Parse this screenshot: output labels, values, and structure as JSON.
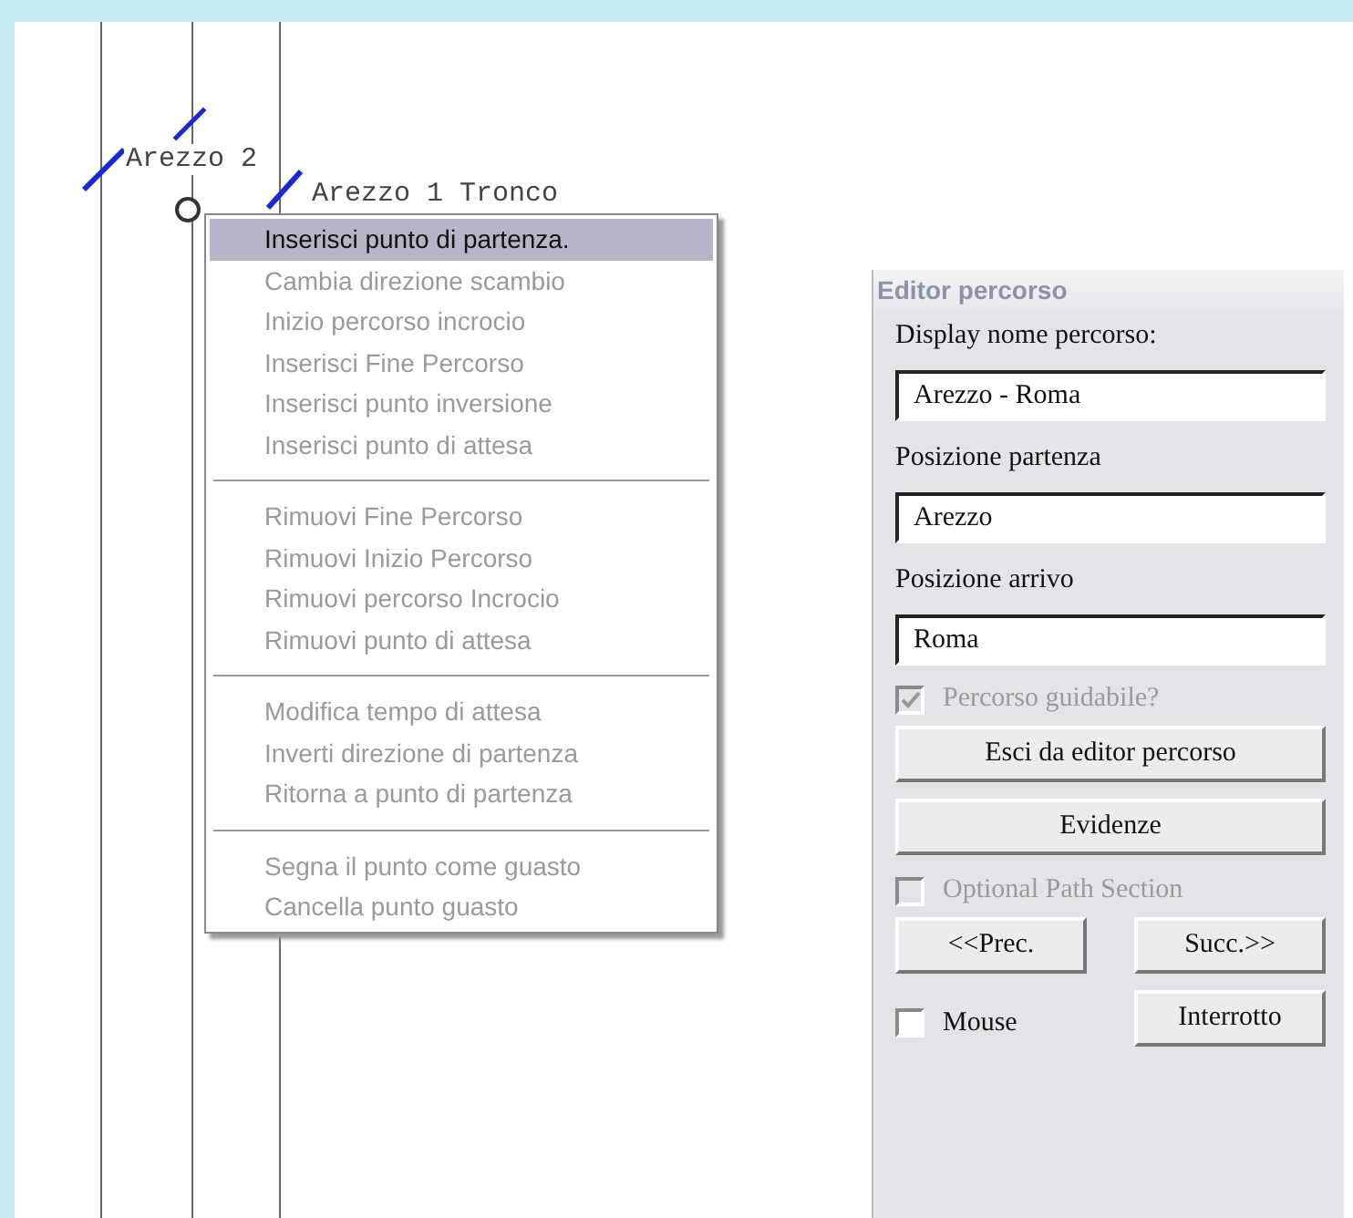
{
  "canvas": {
    "labels": [
      "Arezzo 2",
      "Arezzo 1 Tronco"
    ]
  },
  "context_menu": {
    "groups": [
      [
        {
          "label": "Inserisci punto di partenza.",
          "disabled": false,
          "selected": true
        },
        {
          "label": "Cambia direzione scambio",
          "disabled": true,
          "selected": false
        },
        {
          "label": "Inizio percorso incrocio",
          "disabled": true,
          "selected": false
        },
        {
          "label": "Inserisci Fine Percorso",
          "disabled": true,
          "selected": false
        },
        {
          "label": "Inserisci punto inversione",
          "disabled": true,
          "selected": false
        },
        {
          "label": "Inserisci punto di attesa",
          "disabled": true,
          "selected": false
        }
      ],
      [
        {
          "label": "Rimuovi Fine Percorso",
          "disabled": true,
          "selected": false
        },
        {
          "label": "Rimuovi Inizio Percorso",
          "disabled": true,
          "selected": false
        },
        {
          "label": "Rimuovi percorso Incrocio",
          "disabled": true,
          "selected": false
        },
        {
          "label": "Rimuovi punto di attesa",
          "disabled": true,
          "selected": false
        }
      ],
      [
        {
          "label": "Modifica tempo di attesa",
          "disabled": true,
          "selected": false
        },
        {
          "label": "Inverti direzione di partenza",
          "disabled": true,
          "selected": false
        },
        {
          "label": "Ritorna a punto di partenza",
          "disabled": true,
          "selected": false
        }
      ],
      [
        {
          "label": "Segna il punto come guasto",
          "disabled": true,
          "selected": false
        },
        {
          "label": "Cancella punto guasto",
          "disabled": true,
          "selected": false
        }
      ]
    ]
  },
  "panel": {
    "title": "Editor percorso",
    "fields": [
      {
        "label": "Display nome percorso:",
        "value": "Arezzo - Roma"
      },
      {
        "label": "Posizione partenza",
        "value": "Arezzo"
      },
      {
        "label": "Posizione arrivo",
        "value": "Roma"
      }
    ],
    "driveable": {
      "label": "Percorso guidabile?",
      "checked": true,
      "disabled": true
    },
    "exit_button": "Esci da editor percorso",
    "highlights_button": "Evidenze",
    "optional": {
      "label": "Optional Path Section",
      "checked": false,
      "disabled": true
    },
    "prev_button": "<<Prec.",
    "next_button": "Succ.>>",
    "mouse": {
      "label": "Mouse",
      "checked": false,
      "disabled": false
    },
    "interrupted_button": "Interrotto"
  }
}
